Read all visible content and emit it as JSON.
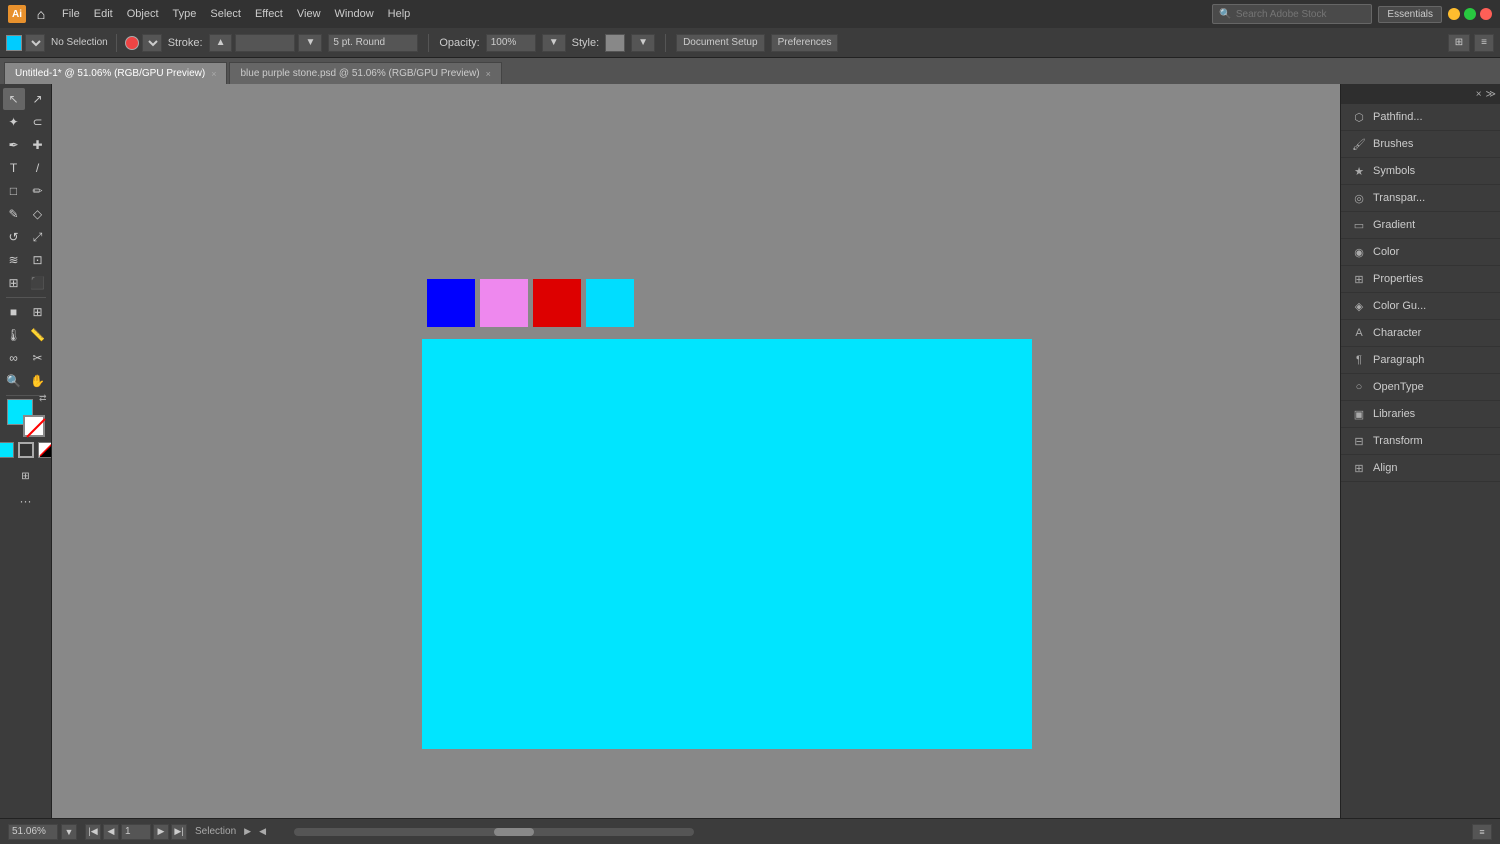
{
  "titlebar": {
    "app_name": "Adobe Illustrator",
    "menu_items": [
      "File",
      "Edit",
      "Object",
      "Type",
      "Select",
      "Effect",
      "View",
      "Window",
      "Help"
    ]
  },
  "workspace": {
    "name": "Essentials",
    "search_placeholder": "Search Adobe Stock"
  },
  "options_bar": {
    "no_selection": "No Selection",
    "stroke_label": "Stroke:",
    "brush_size": "5 pt. Round",
    "opacity_label": "Opacity:",
    "opacity_value": "100%",
    "style_label": "Style:",
    "doc_setup": "Document Setup",
    "preferences": "Preferences"
  },
  "tabs": [
    {
      "label": "Untitled-1* @ 51.06% (RGB/GPU Preview)",
      "active": true
    },
    {
      "label": "blue purple stone.psd @ 51.06% (RGB/GPU Preview)",
      "active": false
    }
  ],
  "canvas": {
    "bg_color": "#888888",
    "doc_color": "#00e5ff",
    "swatches": [
      "#0000ff",
      "#ee88ee",
      "#dd0000",
      "#00ddff"
    ]
  },
  "right_panel": {
    "items": [
      {
        "icon": "⬡",
        "label": "Pathfind..."
      },
      {
        "icon": "🖌",
        "label": "Brushes"
      },
      {
        "icon": "★",
        "label": "Symbols"
      },
      {
        "icon": "◎",
        "label": "Transpar..."
      },
      {
        "icon": "▭",
        "label": "Gradient"
      },
      {
        "icon": "◉",
        "label": "Color"
      },
      {
        "icon": "⊞",
        "label": "Properties"
      },
      {
        "icon": "◈",
        "label": "Color Gu..."
      },
      {
        "icon": "A",
        "label": "Character"
      },
      {
        "icon": "¶",
        "label": "Paragraph"
      },
      {
        "icon": "○",
        "label": "OpenType"
      },
      {
        "icon": "▣",
        "label": "Libraries"
      },
      {
        "icon": "⊟",
        "label": "Transform"
      },
      {
        "icon": "⊞",
        "label": "Align"
      }
    ]
  },
  "status_bar": {
    "zoom": "51.06%",
    "artboard": "1",
    "tool": "Selection"
  },
  "colors": {
    "fill": "#00e5ff",
    "stroke": "#ffffff",
    "accent": "#e8912d"
  }
}
